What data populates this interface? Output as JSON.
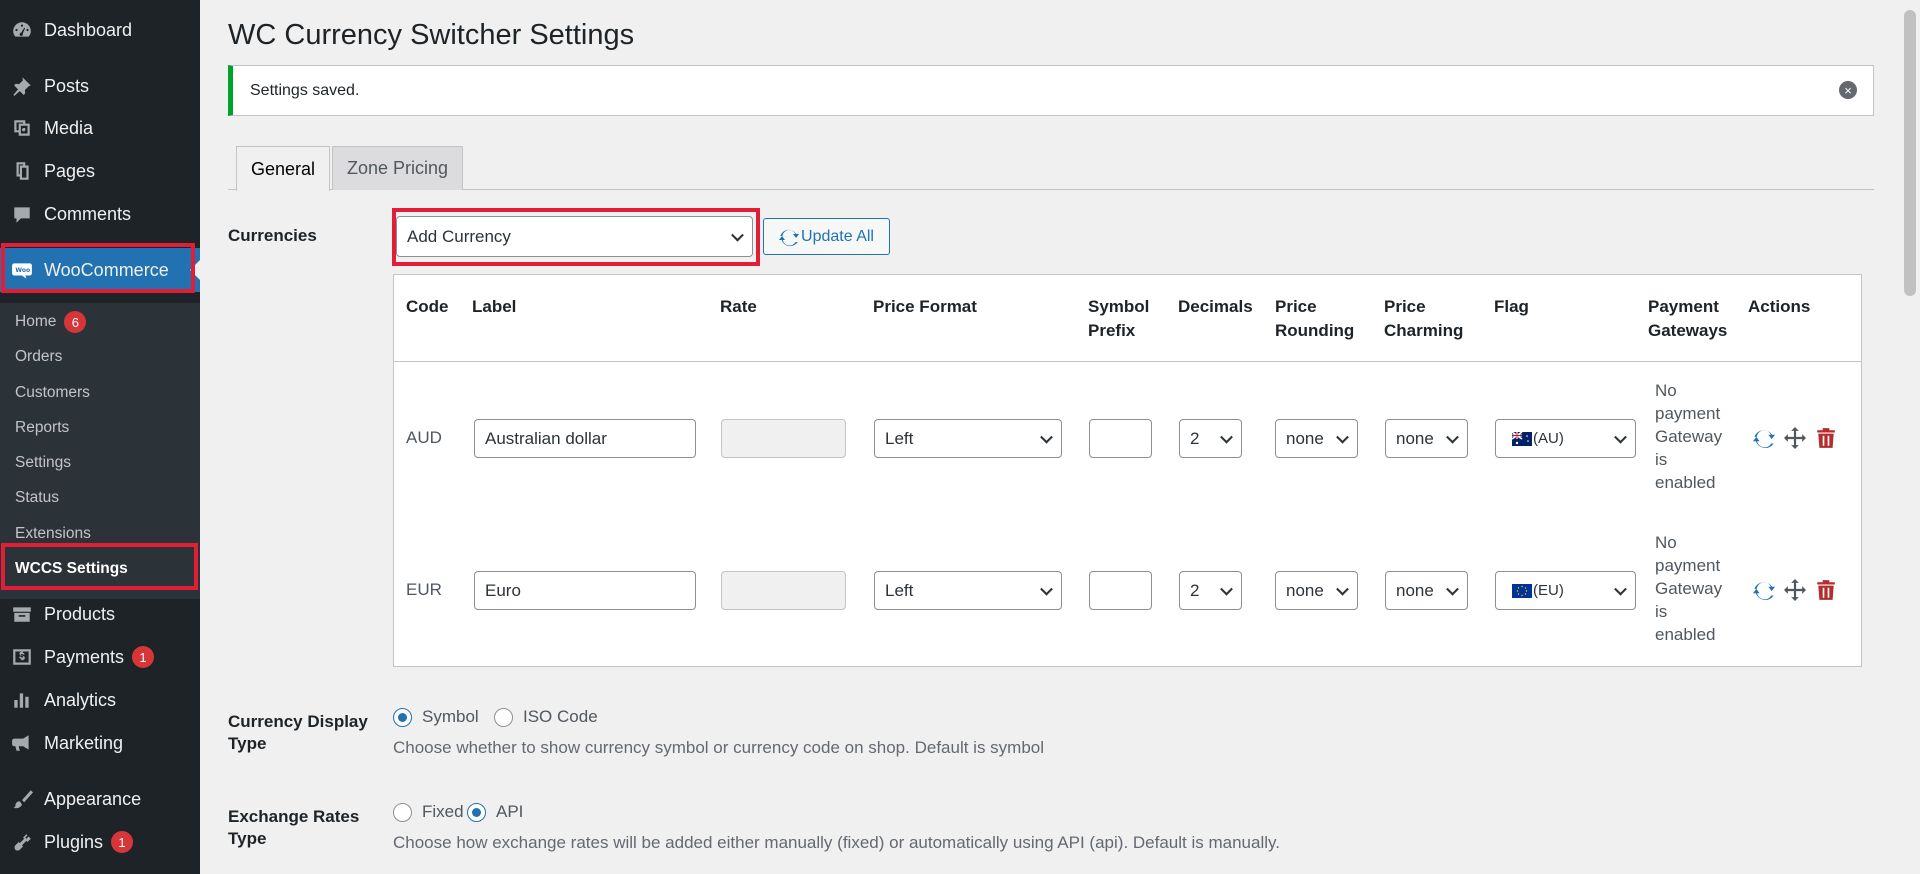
{
  "sidebar": {
    "top": {
      "dashboard": "Dashboard",
      "posts": "Posts",
      "media": "Media",
      "pages": "Pages",
      "comments": "Comments",
      "woocommerce": "WooCommerce"
    },
    "woo_sub": [
      "Home",
      "Orders",
      "Customers",
      "Reports",
      "Settings",
      "Status",
      "Extensions",
      "WCCS Settings"
    ],
    "home_badge": "6",
    "bottom": {
      "products": "Products",
      "payments": "Payments",
      "payments_badge": "1",
      "analytics": "Analytics",
      "marketing": "Marketing",
      "appearance": "Appearance",
      "plugins": "Plugins",
      "plugins_badge": "1"
    }
  },
  "page": {
    "title": "WC Currency Switcher Settings",
    "notice": "Settings saved.",
    "tabs": [
      "General",
      "Zone Pricing"
    ]
  },
  "currencies": {
    "label": "Currencies",
    "add_placeholder": "Add Currency",
    "update_all": "Update All",
    "headers": {
      "code": "Code",
      "label": "Label",
      "rate": "Rate",
      "price_format": "Price Format",
      "symbol_prefix_1": "Symbol",
      "symbol_prefix_2": "Prefix",
      "decimals": "Decimals",
      "rounding_1": "Price",
      "rounding_2": "Rounding",
      "charming_1": "Price",
      "charming_2": "Charming",
      "flag": "Flag",
      "gateways_1": "Payment",
      "gateways_2": "Gateways",
      "actions": "Actions"
    },
    "rows": [
      {
        "code": "AUD",
        "label": "Australian dollar",
        "rate": "",
        "price_format": "Left",
        "symbol_prefix": "",
        "decimals": "2",
        "rounding": "none",
        "charming": "none",
        "flag": "(AU)",
        "gateway_lines": [
          "No",
          "payment",
          "Gateway",
          "is",
          "enabled"
        ]
      },
      {
        "code": "EUR",
        "label": "Euro",
        "rate": "",
        "price_format": "Left",
        "symbol_prefix": "",
        "decimals": "2",
        "rounding": "none",
        "charming": "none",
        "flag": "(EU)",
        "gateway_lines": [
          "No",
          "payment",
          "Gateway",
          "is",
          "enabled"
        ]
      }
    ]
  },
  "display_type": {
    "label_1": "Currency Display",
    "label_2": "Type",
    "options": [
      "Symbol",
      "ISO Code"
    ],
    "selected": "Symbol",
    "description": "Choose whether to show currency symbol or currency code on shop. Default is symbol"
  },
  "exchange_type": {
    "label_1": "Exchange Rates",
    "label_2": "Type",
    "options": [
      "Fixed",
      "API"
    ],
    "selected": "API",
    "description": "Choose how exchange rates will be added either manually (fixed) or automatically using API (api). Default is manually."
  },
  "colors": {
    "accent": "#2271b1",
    "highlight": "#e01e37",
    "success": "#00a32a",
    "danger": "#d63638"
  }
}
